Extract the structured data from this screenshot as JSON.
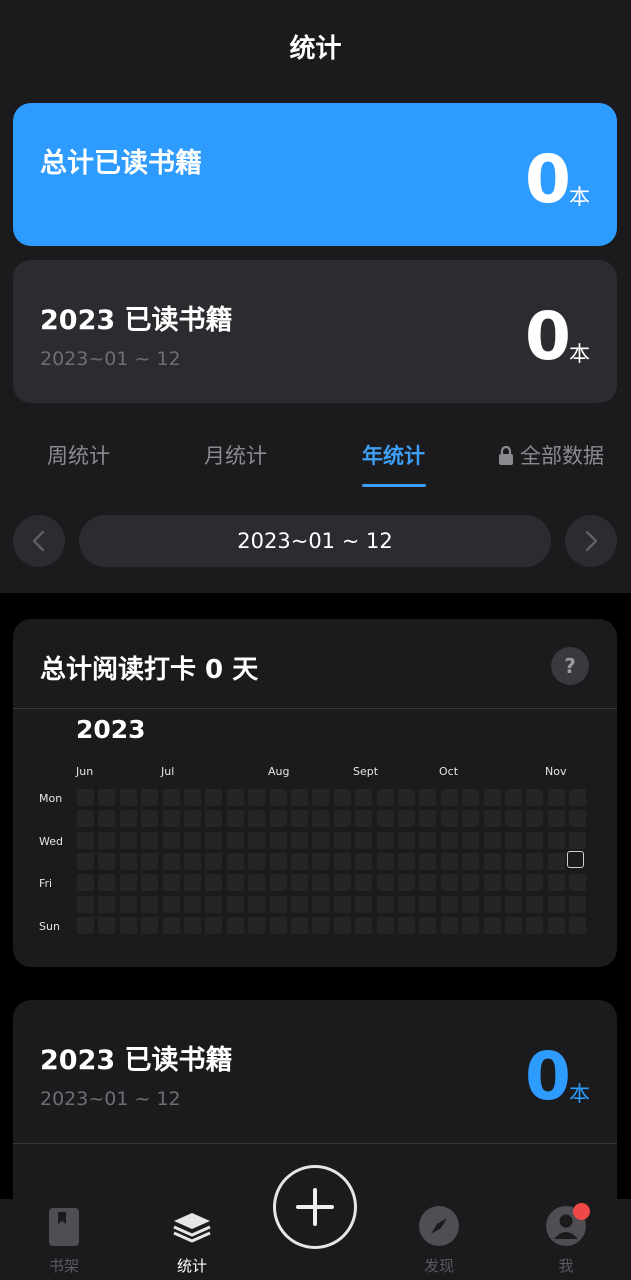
{
  "header": {
    "title": "统计"
  },
  "total_card": {
    "title": "总计已读书籍",
    "count": "0",
    "unit": "本",
    "bg_color": "#2e9bff"
  },
  "year_card": {
    "title": "2023 已读书籍",
    "range": "2023~01 ~ 12",
    "count": "0",
    "unit": "本"
  },
  "tabs": [
    {
      "label": "周统计",
      "active": false
    },
    {
      "label": "月统计",
      "active": false
    },
    {
      "label": "年统计",
      "active": true
    },
    {
      "label": "全部数据",
      "active": false,
      "icon": "lock-icon"
    }
  ],
  "range_selector": {
    "label": "2023~01 ~ 12"
  },
  "checkin": {
    "title": "总计阅读打卡 0 天",
    "help_label": "?",
    "year": "2023",
    "months": [
      "Jun",
      "Jul",
      "Aug",
      "Sept",
      "Oct",
      "Nov"
    ],
    "days": [
      "Mon",
      "Wed",
      "Fri",
      "Sun"
    ]
  },
  "year_card_2": {
    "title": "2023 已读书籍",
    "range": "2023~01 ~ 12",
    "count": "0",
    "unit": "本",
    "count_color": "#2e9bff"
  },
  "bottom_nav": [
    {
      "label": "书架",
      "icon": "bookshelf-icon",
      "active": false
    },
    {
      "label": "统计",
      "icon": "stats-layers-icon",
      "active": true
    },
    {
      "label": "发现",
      "icon": "compass-icon",
      "active": false
    },
    {
      "label": "我",
      "icon": "profile-icon",
      "active": false
    }
  ],
  "accent_color": "#3d9ef5"
}
